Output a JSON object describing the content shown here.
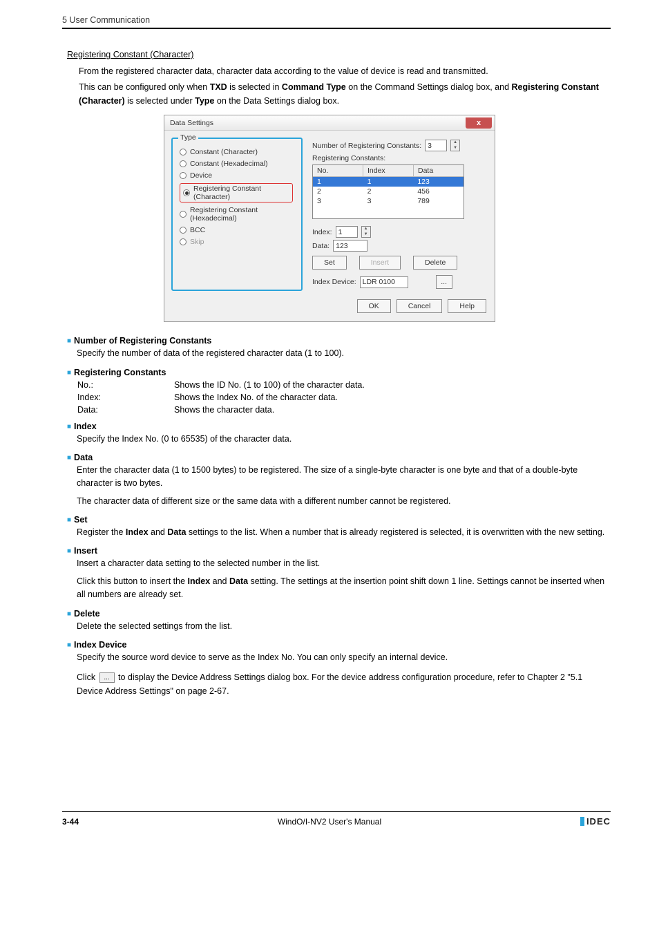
{
  "header": {
    "chapter": "5 User Communication"
  },
  "section": {
    "title": "Registering Constant (Character)",
    "para1": "From the registered character data, character data according to the value of device is read and transmitted.",
    "para2_pre": "This can be configured only when ",
    "para2_b1": "TXD",
    "para2_mid1": " is selected in ",
    "para2_b2": "Command Type",
    "para2_mid2": " on the Command Settings dialog box, and ",
    "para2_b3": "Registering Constant (Character)",
    "para2_mid3": " is selected under ",
    "para2_b4": "Type",
    "para2_end": " on the Data Settings dialog box."
  },
  "dialog": {
    "title": "Data Settings",
    "close": "x",
    "type_legend": "Type",
    "types": {
      "cc": "Constant (Character)",
      "ch": "Constant (Hexadecimal)",
      "dev": "Device",
      "rcc": "Registering Constant (Character)",
      "rch": "Registering Constant (Hexadecimal)",
      "bcc": "BCC",
      "skip": "Skip"
    },
    "num_label": "Number of Registering Constants:",
    "num_value": "3",
    "list_label": "Registering Constants:",
    "cols": {
      "no": "No.",
      "idx": "Index",
      "data": "Data"
    },
    "rows": [
      {
        "no": "1",
        "idx": "1",
        "data": "123"
      },
      {
        "no": "2",
        "idx": "2",
        "data": "456"
      },
      {
        "no": "3",
        "idx": "3",
        "data": "789"
      }
    ],
    "index_label": "Index:",
    "index_value": "1",
    "data_label": "Data:",
    "data_value": "123",
    "btn_set": "Set",
    "btn_insert": "Insert",
    "btn_delete": "Delete",
    "idxdev_label": "Index Device:",
    "idxdev_value": "LDR 0100",
    "browse": "...",
    "ok": "OK",
    "cancel": "Cancel",
    "help": "Help"
  },
  "desc": {
    "nrc_h": "Number of Registering Constants",
    "nrc_b": "Specify the number of data of the registered character data (1 to 100).",
    "rc_h": "Registering Constants",
    "rc_rows": {
      "no_l": "No.:",
      "no_v": "Shows the ID No. (1 to 100) of the character data.",
      "idx_l": "Index:",
      "idx_v": "Shows the Index No. of the character data.",
      "data_l": "Data:",
      "data_v": "Shows the character data."
    },
    "idx_h": "Index",
    "idx_b": "Specify the Index No. (0 to 65535) of the character data.",
    "data_h": "Data",
    "data_b1": "Enter the character data (1 to 1500 bytes) to be registered. The size of a single-byte character is one byte and that of a double-byte character is two bytes.",
    "data_b2": "The character data of different size or the same data with a different number cannot be registered.",
    "set_h": "Set",
    "set_b_pre": "Register the ",
    "set_b_b1": "Index",
    "set_b_mid": " and ",
    "set_b_b2": "Data",
    "set_b_post": " settings to the list. When a number that is already registered is selected, it is overwritten with the new setting.",
    "ins_h": "Insert",
    "ins_b1": "Insert a character data setting to the selected number in the list.",
    "ins_b2_pre": "Click this button to insert the ",
    "ins_b2_b1": "Index",
    "ins_b2_mid": " and ",
    "ins_b2_b2": "Data",
    "ins_b2_post": " setting. The settings at the insertion point shift down 1 line. Settings cannot be inserted when all numbers are already set.",
    "del_h": "Delete",
    "del_b": "Delete the selected settings from the list.",
    "idxdev_h": "Index Device",
    "idxdev_b1": "Specify the source word device to serve as the Index No. You can only specify an internal device.",
    "idxdev_b2_pre": "Click ",
    "idxdev_b2_btn": "...",
    "idxdev_b2_post": " to display the Device Address Settings dialog box. For the device address configuration procedure, refer to Chapter 2 \"5.1 Device Address Settings\" on page 2-67."
  },
  "footer": {
    "page": "3-44",
    "manual": "WindO/I-NV2 User's Manual",
    "brand": "IDEC"
  }
}
